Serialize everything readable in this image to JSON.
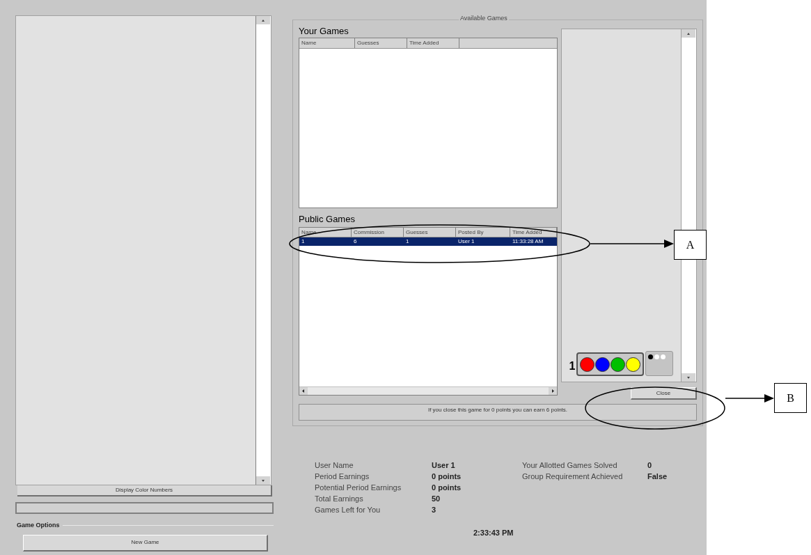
{
  "left_panel": {
    "display_button": "Display Color Numbers"
  },
  "game_options": {
    "title": "Game Options",
    "new_game_button": "New Game"
  },
  "available_games": {
    "title": "Available Games",
    "your_games": {
      "title": "Your Games",
      "columns": [
        "Name",
        "Guesses",
        "Time Added"
      ]
    },
    "public_games": {
      "title": "Public Games",
      "columns": [
        "Name",
        "Commission",
        "Guesses",
        "Posted By",
        "Time Added"
      ],
      "rows": [
        {
          "cells": [
            "1",
            "6",
            "1",
            "User 1",
            "11:33:28 AM"
          ],
          "selected": true
        }
      ]
    },
    "preview": {
      "guess_number": "1",
      "pegs": [
        {
          "color": "#ff0000"
        },
        {
          "color": "#0000ff"
        },
        {
          "color": "#00c000"
        },
        {
          "color": "#ffff00"
        }
      ],
      "feedback": [
        {
          "color": "#000000"
        },
        {
          "color": "#ffffff"
        },
        {
          "color": "#ffffff"
        }
      ]
    },
    "close_button": "Close",
    "message": "If you close this game for 0 points you can earn 6 points."
  },
  "stats": [
    {
      "label": "User Name",
      "value": "User 1"
    },
    {
      "label": "Period Earnings",
      "value": "0 points"
    },
    {
      "label": "Potential Period Earnings",
      "value": "0 points"
    },
    {
      "label": "Total Earnings",
      "value": "50"
    },
    {
      "label": "Games Left for You",
      "value": "3"
    }
  ],
  "stats_right": [
    {
      "label": "Your Allotted Games Solved",
      "value": "0"
    },
    {
      "label": "Group Requirement Achieved",
      "value": "False"
    }
  ],
  "clock": "2:33:43 PM",
  "annotations": [
    {
      "label": "A"
    },
    {
      "label": "B"
    }
  ]
}
